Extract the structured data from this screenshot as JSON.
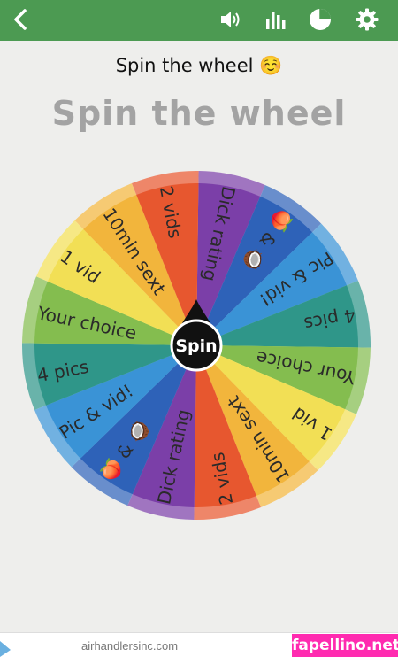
{
  "colors": {
    "topbar": "#4c9a52",
    "title_gray": "#a3a3a3",
    "hub": "#111111",
    "ad_brand_bg": "#ff2bb0"
  },
  "toolbar": {
    "icons": [
      "chevron-left-icon",
      "volume-icon",
      "bar-chart-icon",
      "pie-chart-icon",
      "gear-icon"
    ]
  },
  "caption": "Spin the wheel ☺️",
  "title": "Spin the wheel",
  "wheel": {
    "spin_label": "Spin",
    "segments": [
      {
        "label": "Dick rating",
        "color": "#7b3fa8"
      },
      {
        "label": "🍑 & 🥥",
        "color": "#2e62b8"
      },
      {
        "label": "Pic & vid!",
        "color": "#3a93d6"
      },
      {
        "label": "4 pics",
        "color": "#2f9689"
      },
      {
        "label": "Your choice",
        "color": "#84bd4f"
      },
      {
        "label": "1 vid",
        "color": "#f2df55"
      },
      {
        "label": "10min sext",
        "color": "#f2b53c"
      },
      {
        "label": "2 vids",
        "color": "#e7572f"
      },
      {
        "label": "Dick rating",
        "color": "#7b3fa8"
      },
      {
        "label": "🍑 & 🥥",
        "color": "#2e62b8"
      },
      {
        "label": "Pic & vid!",
        "color": "#3a93d6"
      },
      {
        "label": "4 pics",
        "color": "#2f9689"
      },
      {
        "label": "Your choice",
        "color": "#84bd4f"
      },
      {
        "label": "1 vid",
        "color": "#f2df55"
      },
      {
        "label": "10min sext",
        "color": "#f2b53c"
      },
      {
        "label": "2 vids",
        "color": "#e7572f"
      }
    ]
  },
  "ad": {
    "domain": "airhandlersinc.com",
    "brand": "fapellino.net"
  }
}
